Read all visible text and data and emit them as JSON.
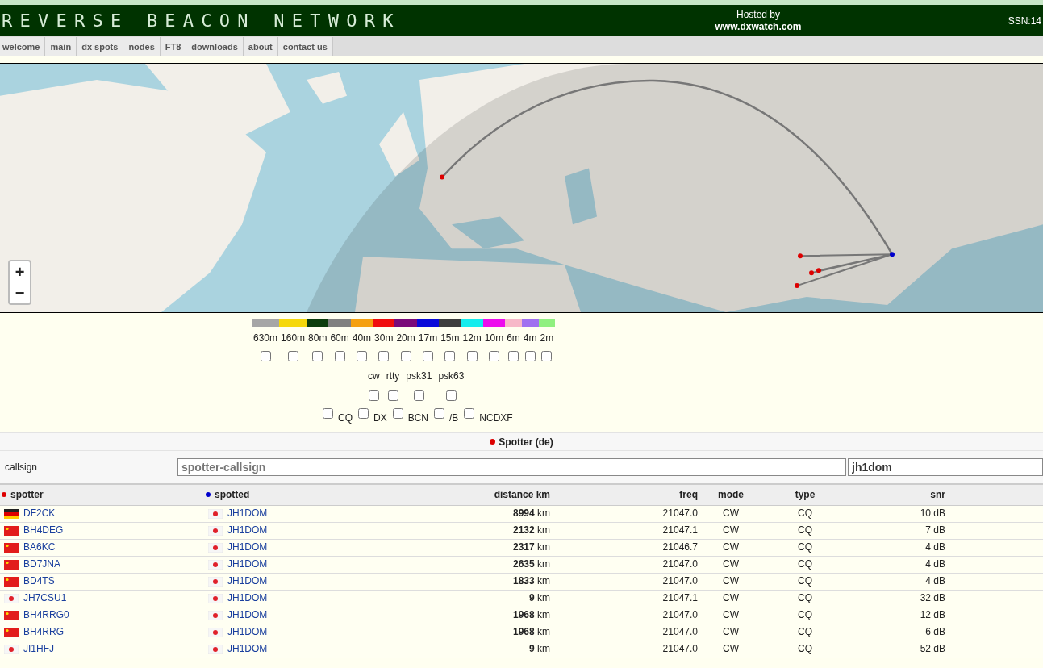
{
  "header": {
    "title": "REVERSE BEACON NETWORK",
    "hosted_label": "Hosted by",
    "hosted_site": "www.dxwatch.com",
    "ssn": "SSN:14"
  },
  "nav": [
    {
      "label": "welcome",
      "selected": false
    },
    {
      "label": "main",
      "selected": false
    },
    {
      "label": "dx spots",
      "selected": false
    },
    {
      "label": "nodes",
      "selected": false
    },
    {
      "label": "FT8",
      "selected": false
    },
    {
      "label": "downloads",
      "selected": false
    },
    {
      "label": "about",
      "selected": false
    },
    {
      "label": "contact us",
      "selected": false
    }
  ],
  "map": {
    "kind": "picture",
    "zoom_in": "+",
    "zoom_out": "−"
  },
  "bands": [
    {
      "label": "630m",
      "color": "#a6a6a6",
      "checked": false
    },
    {
      "label": "160m",
      "color": "#f5d80b",
      "checked": false
    },
    {
      "label": "80m",
      "color": "#0c3d0c",
      "checked": false
    },
    {
      "label": "60m",
      "color": "#808080",
      "checked": false
    },
    {
      "label": "40m",
      "color": "#f5a00f",
      "checked": false
    },
    {
      "label": "30m",
      "color": "#f00d0d",
      "checked": false
    },
    {
      "label": "20m",
      "color": "#7a0a7a",
      "checked": false
    },
    {
      "label": "17m",
      "color": "#0a0ad9",
      "checked": false
    },
    {
      "label": "15m",
      "color": "#3d3d3d",
      "checked": false
    },
    {
      "label": "12m",
      "color": "#14eded",
      "checked": false
    },
    {
      "label": "10m",
      "color": "#ed0ded",
      "checked": false
    },
    {
      "label": "6m",
      "color": "#f7b8c8",
      "checked": false
    },
    {
      "label": "4m",
      "color": "#a070f0",
      "checked": false
    },
    {
      "label": "2m",
      "color": "#90f080",
      "checked": false
    }
  ],
  "modes": [
    {
      "label": "cw",
      "checked": false
    },
    {
      "label": "rtty",
      "checked": false
    },
    {
      "label": "psk31",
      "checked": false
    },
    {
      "label": "psk63",
      "checked": false
    }
  ],
  "types": [
    {
      "label": "CQ",
      "checked": false
    },
    {
      "label": "DX",
      "checked": false
    },
    {
      "label": "BCN",
      "checked": false
    },
    {
      "label": "/B",
      "checked": false
    },
    {
      "label": "NCDXF",
      "checked": false
    }
  ],
  "spotter_section": {
    "title": "Spotter (de)",
    "callsign_label": "callsign",
    "spotter_placeholder": "spotter-callsign",
    "spotted_value": "jh1dom"
  },
  "table": {
    "columns": [
      "spotter",
      "spotted",
      "distance km",
      "freq",
      "mode",
      "type",
      "snr"
    ],
    "rows": [
      {
        "spotter": {
          "kind": "de",
          "call": "DF2CK"
        },
        "spotted": {
          "kind": "jp",
          "call": "JH1DOM"
        },
        "distance": "8994",
        "unit": "km",
        "freq": "21047.0",
        "mode": "CW",
        "type": "CQ",
        "snr": "10 dB"
      },
      {
        "spotter": {
          "kind": "cn",
          "call": "BH4DEG"
        },
        "spotted": {
          "kind": "jp",
          "call": "JH1DOM"
        },
        "distance": "2132",
        "unit": "km",
        "freq": "21047.1",
        "mode": "CW",
        "type": "CQ",
        "snr": "7 dB"
      },
      {
        "spotter": {
          "kind": "cn",
          "call": "BA6KC"
        },
        "spotted": {
          "kind": "jp",
          "call": "JH1DOM"
        },
        "distance": "2317",
        "unit": "km",
        "freq": "21046.7",
        "mode": "CW",
        "type": "CQ",
        "snr": "4 dB"
      },
      {
        "spotter": {
          "kind": "cn",
          "call": "BD7JNA"
        },
        "spotted": {
          "kind": "jp",
          "call": "JH1DOM"
        },
        "distance": "2635",
        "unit": "km",
        "freq": "21047.0",
        "mode": "CW",
        "type": "CQ",
        "snr": "4 dB"
      },
      {
        "spotter": {
          "kind": "cn",
          "call": "BD4TS"
        },
        "spotted": {
          "kind": "jp",
          "call": "JH1DOM"
        },
        "distance": "1833",
        "unit": "km",
        "freq": "21047.0",
        "mode": "CW",
        "type": "CQ",
        "snr": "4 dB"
      },
      {
        "spotter": {
          "kind": "jp",
          "call": "JH7CSU1"
        },
        "spotted": {
          "kind": "jp",
          "call": "JH1DOM"
        },
        "distance": "9",
        "unit": "km",
        "freq": "21047.1",
        "mode": "CW",
        "type": "CQ",
        "snr": "32 dB"
      },
      {
        "spotter": {
          "kind": "cn",
          "call": "BH4RRG0"
        },
        "spotted": {
          "kind": "jp",
          "call": "JH1DOM"
        },
        "distance": "1968",
        "unit": "km",
        "freq": "21047.0",
        "mode": "CW",
        "type": "CQ",
        "snr": "12 dB"
      },
      {
        "spotter": {
          "kind": "cn",
          "call": "BH4RRG"
        },
        "spotted": {
          "kind": "jp",
          "call": "JH1DOM"
        },
        "distance": "1968",
        "unit": "km",
        "freq": "21047.0",
        "mode": "CW",
        "type": "CQ",
        "snr": "6 dB"
      },
      {
        "spotter": {
          "kind": "jp",
          "call": "JI1HFJ"
        },
        "spotted": {
          "kind": "jp",
          "call": "JH1DOM"
        },
        "distance": "9",
        "unit": "km",
        "freq": "21047.0",
        "mode": "CW",
        "type": "CQ",
        "snr": "52 dB"
      }
    ]
  }
}
